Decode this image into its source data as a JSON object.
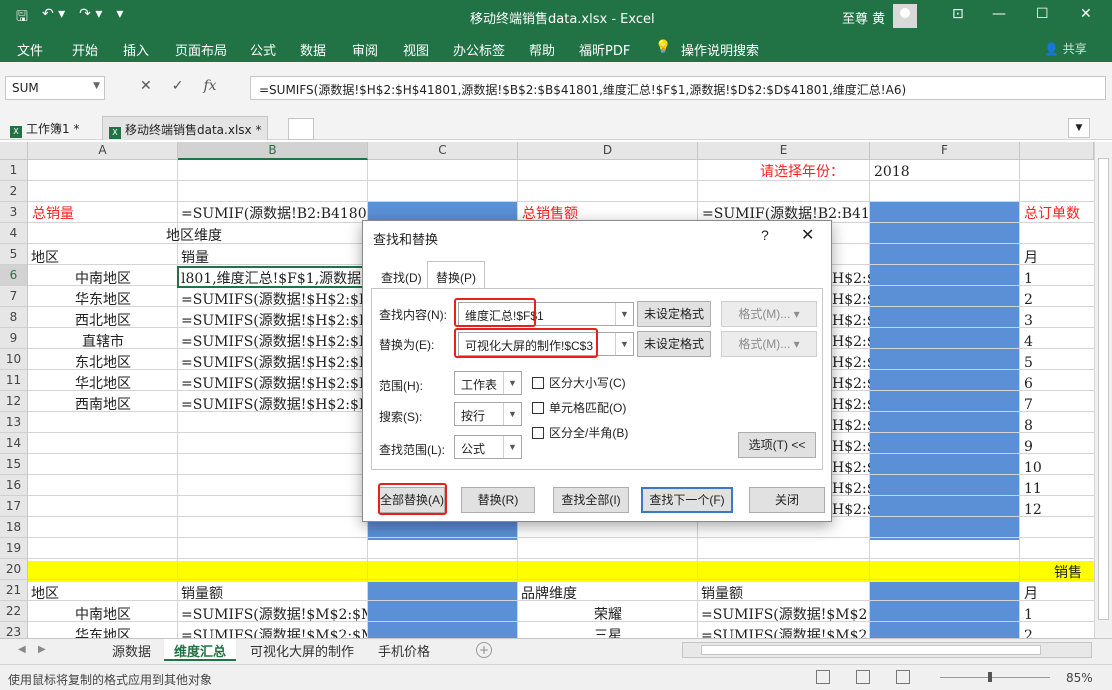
{
  "window": {
    "title": "移动终端销售data.xlsx  -  Excel",
    "user": "至尊 黄",
    "qat": {
      "save": "🖫",
      "undo": "↶ ▾",
      "redo": "↷ ▾",
      "customize": "▾"
    },
    "controls": {
      "ribbon_options": "⊡",
      "minimize": "—",
      "maximize": "☐",
      "close": "✕"
    }
  },
  "ribbon": {
    "tabs": [
      "文件",
      "开始",
      "插入",
      "页面布局",
      "公式",
      "数据",
      "审阅",
      "视图",
      "办公标签",
      "帮助",
      "福昕PDF"
    ],
    "tell_me": "操作说明搜索",
    "share": "共享"
  },
  "formula_bar": {
    "name_box": "SUM",
    "cancel": "✕",
    "enter": "✓",
    "fx": "fx",
    "formula": "=SUMIFS(源数据!$H$2:$H$41801,源数据!$B$2:$B$41801,维度汇总!$F$1,源数据!$D$2:$D$41801,维度汇总!A6)"
  },
  "workbook_tabs": [
    {
      "label": "工作簿1 *",
      "active": false
    },
    {
      "label": "移动终端销售data.xlsx *",
      "active": true
    }
  ],
  "grid": {
    "columns": [
      "A",
      "B",
      "C",
      "D",
      "E",
      "F"
    ],
    "rows": [
      "1",
      "2",
      "3",
      "4",
      "5",
      "6",
      "7",
      "8",
      "9",
      "10",
      "11",
      "12",
      "13",
      "14",
      "15",
      "16",
      "17",
      "18",
      "19",
      "20",
      "21",
      "22",
      "23"
    ],
    "cells": {
      "D1": "请选择年份：",
      "F1": "2018",
      "A3": "总销量",
      "B3": "=SUMIF(源数据!B2:B41801",
      "D3": "总销售额",
      "E3": "=SUMIF(源数据!B2:B4180",
      "G3": "总订单数",
      "AB4": "地区维度",
      "A5": "地区",
      "B5": "销量",
      "G5": "月",
      "A6": "中南地区",
      "B6": "l801,维度汇总!$F$1,源数据",
      "A7": "华东地区",
      "A8": "西北地区",
      "A9": "直辖市",
      "A10": "东北地区",
      "A11": "华北地区",
      "A12": "西南地区",
      "B_formula": "=SUMIFS(源数据!$H$2:$H$",
      "E_formula": "H$2:$H",
      "G_months": [
        "1",
        "2",
        "3",
        "4",
        "5",
        "6",
        "7",
        "8",
        "9",
        "10",
        "11",
        "12"
      ],
      "G20": "销售",
      "A21": "地区",
      "B21": "销量额",
      "D21": "品牌维度",
      "E21": "销量额",
      "G21": "月",
      "A22": "中南地区",
      "B22": "=SUMIFS(源数据!$M$2:$M$4",
      "D22": "荣耀",
      "E22": "=SUMIFS(源数据!$M$2:$M",
      "G22": "1",
      "A23": "华东地区",
      "B23": "=SUMIFS(源数据!$M$2:$M$4",
      "D23": "三星",
      "E23": "=SUMIFS(源数据!$M$2:$M",
      "G23": "2"
    }
  },
  "sheet_tabs": [
    "源数据",
    "维度汇总",
    "可视化大屏的制作",
    "手机价格"
  ],
  "active_sheet": "维度汇总",
  "status": {
    "message": "使用鼠标将复制的格式应用到其他对象",
    "zoom": "85%"
  },
  "dialog": {
    "title": "查找和替换",
    "help": "?",
    "close": "✕",
    "tabs": [
      "查找(D)",
      "替换(P)"
    ],
    "active_tab": "替换(P)",
    "find_label": "查找内容(N):",
    "find_value": "维度汇总!$F$1",
    "replace_label": "替换为(E):",
    "replace_value": "可视化大屏的制作!$C$3",
    "format_not_set": "未设定格式",
    "format_button": "格式(M)...",
    "within_label": "范围(H):",
    "within_value": "工作表",
    "search_label": "搜索(S):",
    "search_value": "按行",
    "lookin_label": "查找范围(L):",
    "lookin_value": "公式",
    "match_case": "区分大小写(C)",
    "match_entire": "单元格匹配(O)",
    "match_byte": "区分全/半角(B)",
    "options_button": "选项(T) <<",
    "replace_all": "全部替换(A)",
    "replace": "替换(R)",
    "find_all": "查找全部(I)",
    "find_next": "查找下一个(F)",
    "close_button": "关闭"
  },
  "colors": {
    "excel_green": "#217346",
    "blue_fill": "#5b8fd6",
    "yellow_fill": "#ffff00",
    "red_text": "#ff2020",
    "highlight_red": "#e8201c"
  }
}
